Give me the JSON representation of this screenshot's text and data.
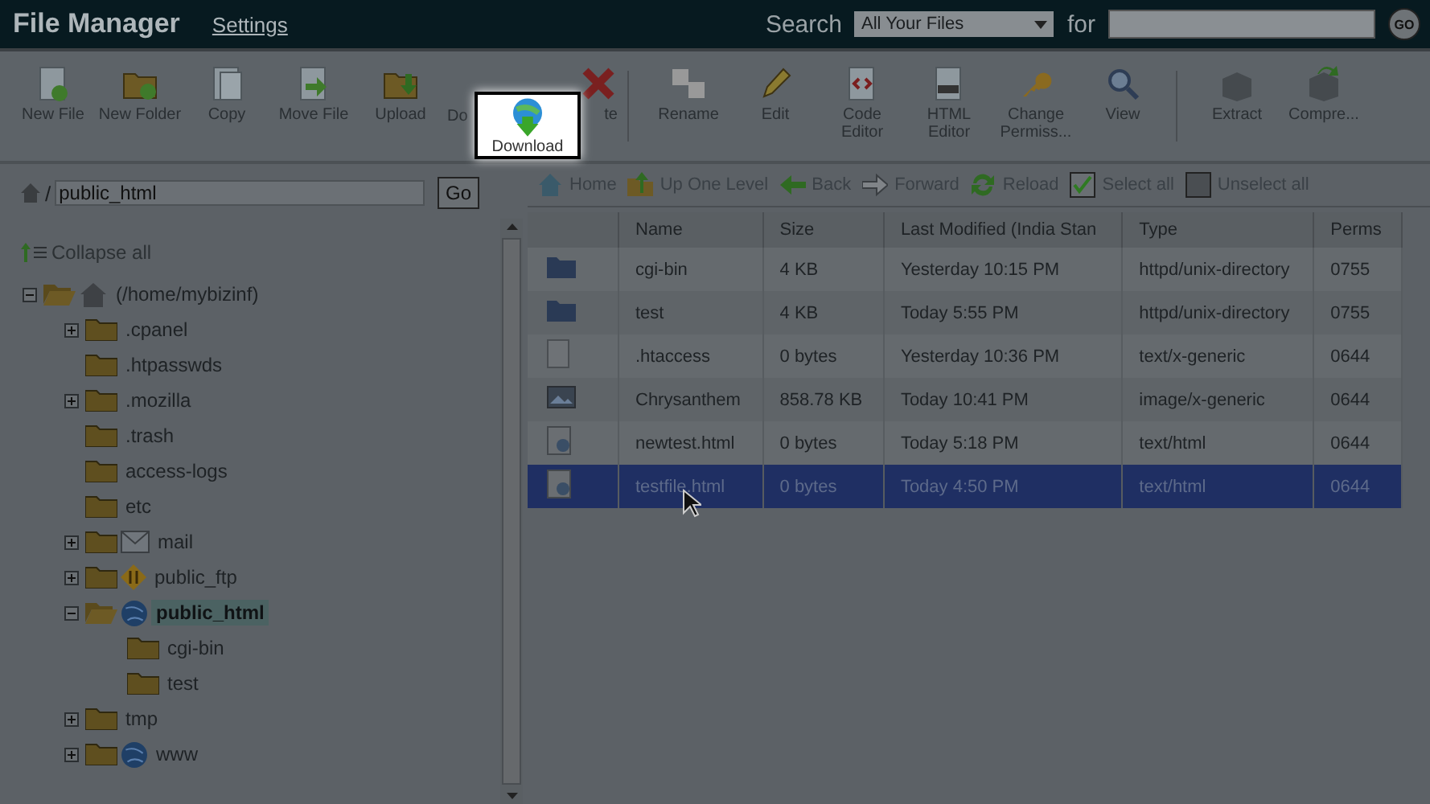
{
  "header": {
    "title": "File Manager",
    "settings_link": "Settings",
    "search_label": "Search",
    "search_scope": "All Your Files",
    "for_label": "for",
    "go_button": "GO"
  },
  "toolbar": [
    {
      "kind": "new_file",
      "label": "New File"
    },
    {
      "kind": "new_folder",
      "label": "New Folder"
    },
    {
      "kind": "copy",
      "label": "Copy"
    },
    {
      "kind": "move",
      "label": "Move File"
    },
    {
      "kind": "upload",
      "label": "Upload"
    },
    {
      "kind": "download",
      "label": "Do",
      "callout": "Download"
    },
    {
      "kind": "delete",
      "label": "te"
    },
    {
      "kind": "divider"
    },
    {
      "kind": "rename",
      "label": "Rename"
    },
    {
      "kind": "edit",
      "label": "Edit"
    },
    {
      "kind": "code",
      "label": "Code Editor"
    },
    {
      "kind": "html",
      "label": "HTML Editor"
    },
    {
      "kind": "perms",
      "label": "Change Permiss..."
    },
    {
      "kind": "view",
      "label": "View"
    },
    {
      "kind": "divider"
    },
    {
      "kind": "extract",
      "label": "Extract"
    },
    {
      "kind": "compress",
      "label": "Compre..."
    }
  ],
  "path_bar": {
    "separator": "/",
    "value": "public_html",
    "go_button": "Go"
  },
  "tree": {
    "collapse_all": "Collapse all",
    "root": {
      "label": "(/home/mybizinf)",
      "kind": "home",
      "expanded": true,
      "selected": false,
      "children": [
        {
          "label": ".cpanel",
          "kind": "folder",
          "expanded": false,
          "selected": false
        },
        {
          "label": ".htpasswds",
          "kind": "folder",
          "selected": false
        },
        {
          "label": ".mozilla",
          "kind": "folder",
          "expanded": false,
          "selected": false
        },
        {
          "label": ".trash",
          "kind": "folder",
          "selected": false
        },
        {
          "label": "access-logs",
          "kind": "folder",
          "selected": false
        },
        {
          "label": "etc",
          "kind": "folder",
          "selected": false
        },
        {
          "label": "mail",
          "kind": "mail",
          "expanded": false,
          "selected": false
        },
        {
          "label": "public_ftp",
          "kind": "ftp",
          "expanded": false,
          "selected": false
        },
        {
          "label": "public_html",
          "kind": "globe",
          "expanded": true,
          "selected": true,
          "children": [
            {
              "label": "cgi-bin",
              "kind": "folder",
              "selected": false
            },
            {
              "label": "test",
              "kind": "folder",
              "selected": false
            }
          ]
        },
        {
          "label": "tmp",
          "kind": "folder",
          "expanded": false,
          "selected": false
        },
        {
          "label": "www",
          "kind": "globe",
          "expanded": false,
          "selected": false
        }
      ]
    }
  },
  "nav": [
    {
      "kind": "home",
      "label": "Home"
    },
    {
      "kind": "up",
      "label": "Up One Level"
    },
    {
      "kind": "back",
      "label": "Back"
    },
    {
      "kind": "forward",
      "label": "Forward"
    },
    {
      "kind": "reload",
      "label": "Reload"
    },
    {
      "kind": "select_all",
      "label": "Select all"
    },
    {
      "kind": "unselect_all",
      "label": "Unselect all"
    }
  ],
  "table": {
    "columns": [
      "Name",
      "Size",
      "Last Modified (India Stan",
      "Type",
      "Perms"
    ],
    "rows": [
      {
        "kind": "folder",
        "name": "cgi-bin",
        "size": "4 KB",
        "modified": "Yesterday 10:15 PM",
        "type": "httpd/unix-directory",
        "perms": "0755",
        "selected": false
      },
      {
        "kind": "folder",
        "name": "test",
        "size": "4 KB",
        "modified": "Today 5:55 PM",
        "type": "httpd/unix-directory",
        "perms": "0755",
        "selected": false
      },
      {
        "kind": "text",
        "name": ".htaccess",
        "size": "0 bytes",
        "modified": "Yesterday 10:36 PM",
        "type": "text/x-generic",
        "perms": "0644",
        "selected": false
      },
      {
        "kind": "image",
        "name": "Chrysanthem",
        "size": "858.78 KB",
        "modified": "Today 10:41 PM",
        "type": "image/x-generic",
        "perms": "0644",
        "selected": false
      },
      {
        "kind": "html",
        "name": "newtest.html",
        "size": "0 bytes",
        "modified": "Today 5:18 PM",
        "type": "text/html",
        "perms": "0644",
        "selected": false
      },
      {
        "kind": "html",
        "name": "testfile.html",
        "size": "0 bytes",
        "modified": "Today 4:50 PM",
        "type": "text/html",
        "perms": "0644",
        "selected": true
      }
    ]
  }
}
